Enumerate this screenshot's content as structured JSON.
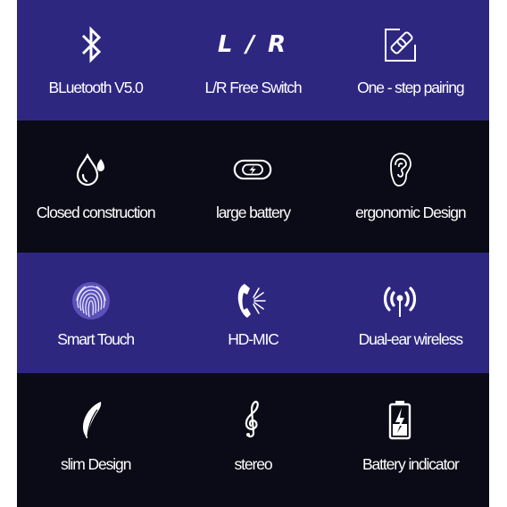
{
  "colors": {
    "band_purple": "#2e2780",
    "band_dark": "#0b0a17",
    "text": "#ffffff"
  },
  "rows": [
    {
      "theme": "purple",
      "features": [
        {
          "icon": "bluetooth-icon",
          "label": "BLuetooth V5.0"
        },
        {
          "icon": "lr-text-icon",
          "icon_text": "L / R",
          "label": "L/R Free Switch"
        },
        {
          "icon": "link-pairing-icon",
          "label": "One - step pairing"
        }
      ]
    },
    {
      "theme": "dark",
      "features": [
        {
          "icon": "water-drop-icon",
          "label": "Closed construction"
        },
        {
          "icon": "battery-charge-icon",
          "label": "large battery"
        },
        {
          "icon": "ear-icon",
          "label": "ergonomic Design"
        }
      ]
    },
    {
      "theme": "purple",
      "features": [
        {
          "icon": "fingerprint-icon",
          "label": "Smart Touch"
        },
        {
          "icon": "phone-mic-icon",
          "label": "HD-MIC"
        },
        {
          "icon": "wireless-antenna-icon",
          "label": "Dual-ear wireless"
        }
      ]
    },
    {
      "theme": "dark",
      "features": [
        {
          "icon": "feather-icon",
          "label": "slim Design"
        },
        {
          "icon": "treble-clef-icon",
          "label": "stereo"
        },
        {
          "icon": "battery-indicator-icon",
          "label": "Battery indicator"
        }
      ]
    }
  ]
}
